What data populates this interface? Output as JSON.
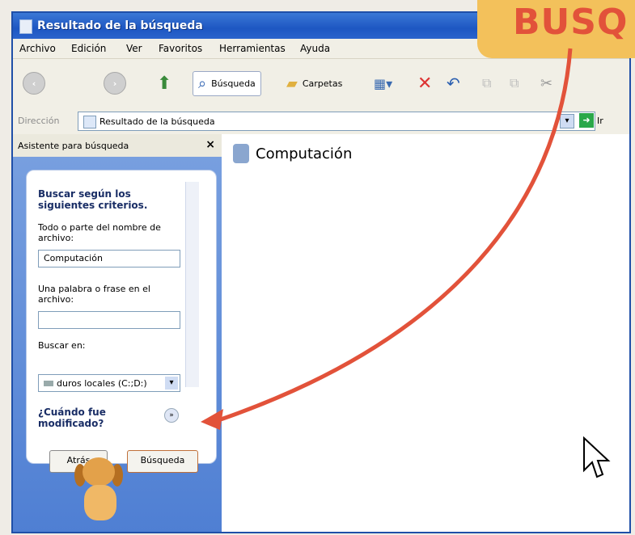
{
  "window": {
    "title": "Resultado de la búsqueda"
  },
  "menu": [
    "Archivo",
    "Edición",
    "Ver",
    "Favoritos",
    "Herramientas",
    "Ayuda"
  ],
  "toolbar": {
    "search_label": "Búsqueda",
    "folders_label": "Carpetas"
  },
  "address": {
    "label": "Dirección",
    "value": "Resultado de la búsqueda",
    "go_label": "Ir"
  },
  "search_pane": {
    "title": "Asistente para búsqueda",
    "heading": "Buscar según los siguientes criterios.",
    "name_label": "Todo o parte del nombre de archivo:",
    "name_value": "Computación",
    "phrase_label": "Una palabra o frase en el archivo:",
    "phrase_value": "",
    "look_in_label": "Buscar en:",
    "look_in_value": "duros locales (C:;D:)",
    "when_label": "¿Cuándo fue modificado?",
    "back_button": "Atrás",
    "search_button": "Búsqueda"
  },
  "results": {
    "folder_name": "Computación"
  },
  "overlay_tag": "BUSQ",
  "colors": {
    "title_bar": "#1e57c2",
    "pane": "#5a86d6",
    "arrow": "#e2523a",
    "tag": "#f3c15b"
  }
}
